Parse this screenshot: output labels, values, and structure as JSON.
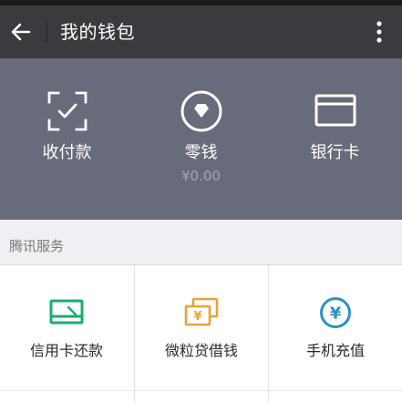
{
  "header": {
    "title": "我的钱包",
    "back_icon": "arrow-left-icon",
    "more_icon": "vertical-dots-icon"
  },
  "wallet": {
    "items": [
      {
        "label": "收付款",
        "icon": "scan-check-icon"
      },
      {
        "label": "零钱",
        "sub": "¥0.00",
        "icon": "coin-diamond-icon"
      },
      {
        "label": "银行卡",
        "icon": "bank-card-icon"
      }
    ]
  },
  "services": {
    "section_title": "腾讯服务",
    "items": [
      {
        "label": "信用卡还款",
        "icon": "credit-card-repay-icon",
        "color": "#1aad6c"
      },
      {
        "label": "微粒贷借钱",
        "icon": "loan-cards-icon",
        "color": "#e8a33a"
      },
      {
        "label": "手机充值",
        "icon": "yuan-circle-icon",
        "color": "#2f90c4"
      }
    ]
  },
  "colors": {
    "header_bg": "#3a3a3f",
    "wallet_bg": "#686b7a",
    "page_bg": "#efeff4"
  }
}
